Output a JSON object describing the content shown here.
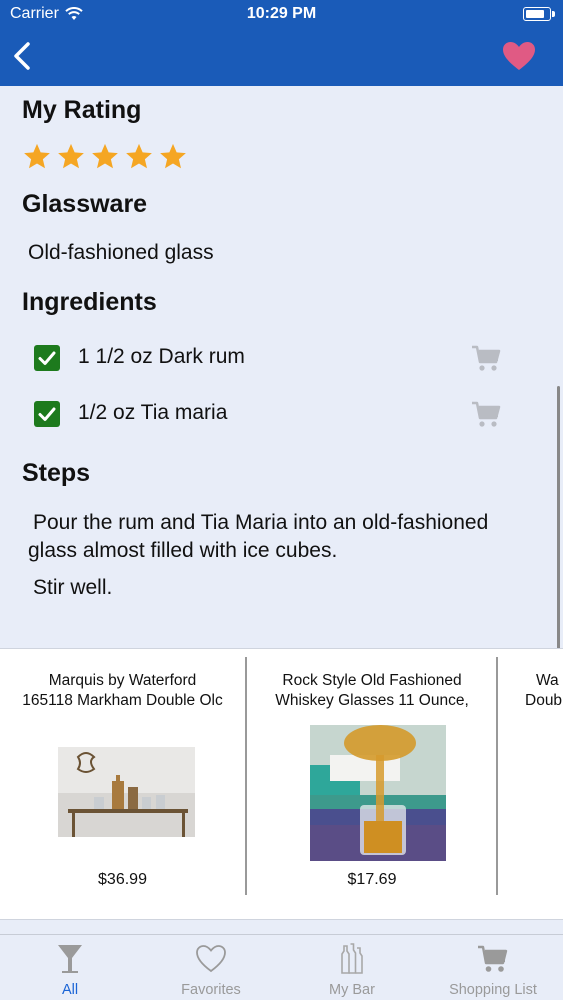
{
  "status": {
    "carrier": "Carrier",
    "time": "10:29 PM"
  },
  "nav": {
    "back_icon": "chevron-left-icon",
    "favorite_icon": "heart-icon",
    "favorite_color": "#e05a84",
    "bar_color": "#1a5bb8"
  },
  "rating": {
    "title": "My Rating",
    "stars": 5,
    "max": 5,
    "color": "#f5a623"
  },
  "glassware": {
    "title": "Glassware",
    "value": "Old-fashioned glass"
  },
  "ingredients": {
    "title": "Ingredients",
    "items": [
      {
        "text": "1 1/2 oz Dark rum",
        "checked": true
      },
      {
        "text": "1/2 oz Tia maria",
        "checked": true
      }
    ]
  },
  "steps": {
    "title": "Steps",
    "items": [
      "Pour the rum and Tia Maria into an old-fashioned glass almost filled with ice cubes.",
      "Stir well."
    ]
  },
  "products": [
    {
      "title_line1": "Marquis by Waterford",
      "title_line2": "165118 Markham Double Olc",
      "price": "$36.99"
    },
    {
      "title_line1": "Rock Style Old Fashioned",
      "title_line2": "Whiskey Glasses 11 Ounce,",
      "price": "$17.69"
    },
    {
      "title_line1": "Wa",
      "title_line2": "Doub",
      "price": ""
    }
  ],
  "tabs": [
    {
      "label": "All",
      "icon": "martini-glass-icon",
      "active": true
    },
    {
      "label": "Favorites",
      "icon": "heart-outline-icon",
      "active": false
    },
    {
      "label": "My Bar",
      "icon": "bottles-icon",
      "active": false
    },
    {
      "label": "Shopping List",
      "icon": "cart-icon",
      "active": false
    }
  ]
}
